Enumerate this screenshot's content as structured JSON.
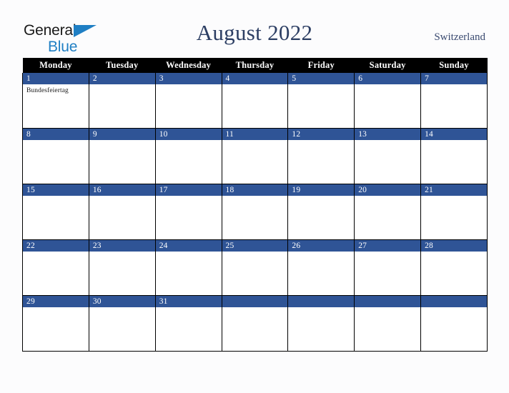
{
  "brand": {
    "name_part1": "General",
    "name_part2": "Blue",
    "triangle_icon": "triangle-icon",
    "color_primary": "#1f7fc4",
    "color_text": "#1a1a1a"
  },
  "header": {
    "title": "August 2022",
    "country": "Switzerland",
    "title_color": "#2c3e63"
  },
  "calendar": {
    "accent_color": "#2f5496",
    "header_bg": "#000000",
    "weekdays": [
      "Monday",
      "Tuesday",
      "Wednesday",
      "Thursday",
      "Friday",
      "Saturday",
      "Sunday"
    ],
    "weeks": [
      [
        {
          "day": "1",
          "events": [
            "Bundesfeiertag"
          ]
        },
        {
          "day": "2",
          "events": []
        },
        {
          "day": "3",
          "events": []
        },
        {
          "day": "4",
          "events": []
        },
        {
          "day": "5",
          "events": []
        },
        {
          "day": "6",
          "events": []
        },
        {
          "day": "7",
          "events": []
        }
      ],
      [
        {
          "day": "8",
          "events": []
        },
        {
          "day": "9",
          "events": []
        },
        {
          "day": "10",
          "events": []
        },
        {
          "day": "11",
          "events": []
        },
        {
          "day": "12",
          "events": []
        },
        {
          "day": "13",
          "events": []
        },
        {
          "day": "14",
          "events": []
        }
      ],
      [
        {
          "day": "15",
          "events": []
        },
        {
          "day": "16",
          "events": []
        },
        {
          "day": "17",
          "events": []
        },
        {
          "day": "18",
          "events": []
        },
        {
          "day": "19",
          "events": []
        },
        {
          "day": "20",
          "events": []
        },
        {
          "day": "21",
          "events": []
        }
      ],
      [
        {
          "day": "22",
          "events": []
        },
        {
          "day": "23",
          "events": []
        },
        {
          "day": "24",
          "events": []
        },
        {
          "day": "25",
          "events": []
        },
        {
          "day": "26",
          "events": []
        },
        {
          "day": "27",
          "events": []
        },
        {
          "day": "28",
          "events": []
        }
      ],
      [
        {
          "day": "29",
          "events": []
        },
        {
          "day": "30",
          "events": []
        },
        {
          "day": "31",
          "events": []
        },
        {
          "day": "",
          "events": []
        },
        {
          "day": "",
          "events": []
        },
        {
          "day": "",
          "events": []
        },
        {
          "day": "",
          "events": []
        }
      ]
    ]
  }
}
